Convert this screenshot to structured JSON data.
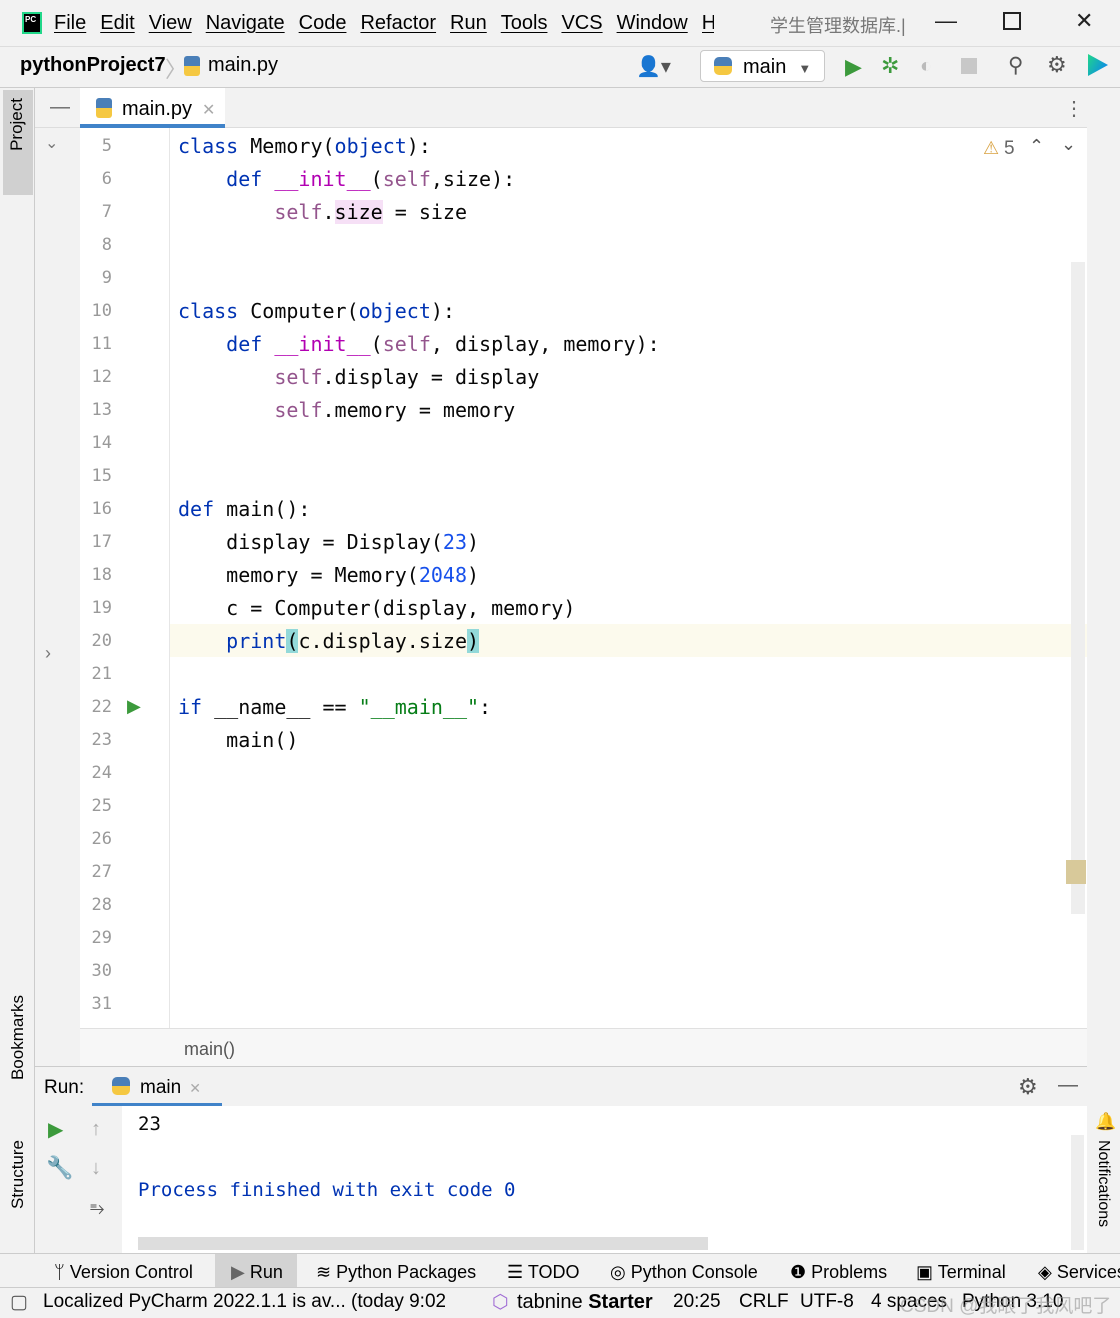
{
  "menu": {
    "items": [
      "File",
      "Edit",
      "View",
      "Navigate",
      "Code",
      "Refactor",
      "Run",
      "Tools",
      "VCS",
      "Window",
      "Help"
    ],
    "window_title": "学生管理数据库.|",
    "logo_text": "PC"
  },
  "nav": {
    "project": "pythonProject7",
    "file": "main.py",
    "run_config": "main"
  },
  "editor": {
    "tab": "main.py",
    "warnings": "5",
    "breadcrumb": "main()",
    "lines": [
      {
        "n": "5",
        "t": [
          [
            "kw",
            "class "
          ],
          [
            "plain",
            "Memory("
          ],
          [
            "kw",
            "object"
          ],
          [
            "plain",
            "):"
          ]
        ]
      },
      {
        "n": "6",
        "t": [
          [
            "plain",
            "    "
          ],
          [
            "kw",
            "def "
          ],
          [
            "dun",
            "__init__"
          ],
          [
            "plain",
            "("
          ],
          [
            "self",
            "self"
          ],
          [
            "plain",
            ",size):"
          ]
        ]
      },
      {
        "n": "7",
        "t": [
          [
            "plain",
            "        "
          ],
          [
            "self",
            "self"
          ],
          [
            "plain",
            "."
          ],
          [
            "wr",
            "size"
          ],
          [
            "plain",
            " = size"
          ]
        ]
      },
      {
        "n": "8",
        "t": []
      },
      {
        "n": "9",
        "t": []
      },
      {
        "n": "10",
        "t": [
          [
            "kw",
            "class "
          ],
          [
            "plain",
            "Computer("
          ],
          [
            "kw",
            "object"
          ],
          [
            "plain",
            "):"
          ]
        ]
      },
      {
        "n": "11",
        "t": [
          [
            "plain",
            "    "
          ],
          [
            "kw",
            "def "
          ],
          [
            "dun",
            "__init__"
          ],
          [
            "plain",
            "("
          ],
          [
            "self",
            "self"
          ],
          [
            "plain",
            ", display, memory):"
          ]
        ]
      },
      {
        "n": "12",
        "t": [
          [
            "plain",
            "        "
          ],
          [
            "self",
            "self"
          ],
          [
            "plain",
            ".display = display"
          ]
        ]
      },
      {
        "n": "13",
        "t": [
          [
            "plain",
            "        "
          ],
          [
            "self",
            "self"
          ],
          [
            "plain",
            ".memory = memory"
          ]
        ]
      },
      {
        "n": "14",
        "t": []
      },
      {
        "n": "15",
        "t": []
      },
      {
        "n": "16",
        "t": [
          [
            "kw",
            "def "
          ],
          [
            "plain",
            "main():"
          ]
        ]
      },
      {
        "n": "17",
        "t": [
          [
            "plain",
            "    display = Display("
          ],
          [
            "num",
            "23"
          ],
          [
            "plain",
            ")"
          ]
        ]
      },
      {
        "n": "18",
        "t": [
          [
            "plain",
            "    memory = Memory("
          ],
          [
            "num",
            "2048"
          ],
          [
            "plain",
            ")"
          ]
        ]
      },
      {
        "n": "19",
        "t": [
          [
            "plain",
            "    c = Computer(display, memory)"
          ]
        ]
      },
      {
        "n": "20",
        "t": [
          [
            "plain",
            "    "
          ],
          [
            "kw",
            "print"
          ],
          [
            "hl",
            "("
          ],
          [
            "plain",
            "c.display.size"
          ],
          [
            "hl",
            ")"
          ]
        ]
      },
      {
        "n": "21",
        "t": []
      },
      {
        "n": "22",
        "t": [
          [
            "kw",
            "if "
          ],
          [
            "plain",
            "__name__ == "
          ],
          [
            "str",
            "\"__main__\""
          ],
          [
            "plain",
            ":"
          ]
        ]
      },
      {
        "n": "23",
        "t": [
          [
            "plain",
            "    main()"
          ]
        ]
      },
      {
        "n": "24",
        "t": []
      },
      {
        "n": "25",
        "t": []
      },
      {
        "n": "26",
        "t": []
      },
      {
        "n": "27",
        "t": []
      },
      {
        "n": "28",
        "t": []
      },
      {
        "n": "29",
        "t": []
      },
      {
        "n": "30",
        "t": []
      },
      {
        "n": "31",
        "t": []
      }
    ]
  },
  "run": {
    "label": "Run:",
    "tab": "main",
    "output": [
      "23",
      "Process finished with exit code 0"
    ]
  },
  "side": {
    "project": "Project",
    "bookmarks": "Bookmarks",
    "structure": "Structure",
    "notifications": "Notifications"
  },
  "bottom_tabs": [
    "Version Control",
    "Run",
    "Python Packages",
    "TODO",
    "Python Console",
    "Problems",
    "Terminal",
    "Services"
  ],
  "status": {
    "message": "Localized PyCharm 2022.1.1 is av... (today 9:02)",
    "tabnine": "tabnine",
    "tabnine_plan": "Starter",
    "position": "20:25",
    "line_sep": "CRLF",
    "encoding": "UTF-8",
    "indent": "4 spaces",
    "interpreter": "Python 3.10",
    "watermark": "CSDN @我眼了我风吧了"
  }
}
